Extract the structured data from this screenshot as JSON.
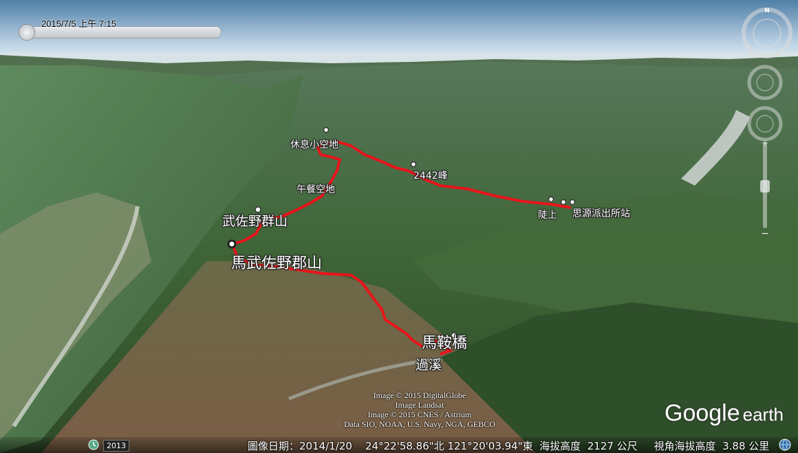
{
  "timestamp": "2015/7/5 上午  7:15",
  "compass": {
    "north": "N"
  },
  "labels": {
    "rest_area": "休息小空地",
    "peak_2442": "2442峰",
    "lunch_area": "午餐空地",
    "wusa_peak": "武佐野群山",
    "mawusa_peak": "馬武佐野郡山",
    "climb_up": "陡上",
    "siyuan_station": "思源派出所站",
    "bridge": "馬鞍橋",
    "cross_stream": "過溪"
  },
  "credits": [
    "Image © 2015 DigitalGlobe",
    "Image Landsat",
    "Image © 2015 CNES / Astrium",
    "Data SIO, NOAA, U.S. Navy, NGA, GEBCO"
  ],
  "logo": {
    "google": "Google",
    "earth": "earth"
  },
  "imagery_year": "2013",
  "status": {
    "date_label": "圖像日期：",
    "date": "2014/1/20",
    "lat": "24°22'58.86\"北",
    "lon": "121°20'03.94\"東",
    "elev_label": "海拔高度",
    "elev": "2127 公尺",
    "eye_label": "視角海拔高度",
    "eye": "3.88 公里"
  },
  "colors": {
    "track": "#e8141b",
    "forest": "#3f6b3a",
    "sky": "#c5d9e8"
  }
}
